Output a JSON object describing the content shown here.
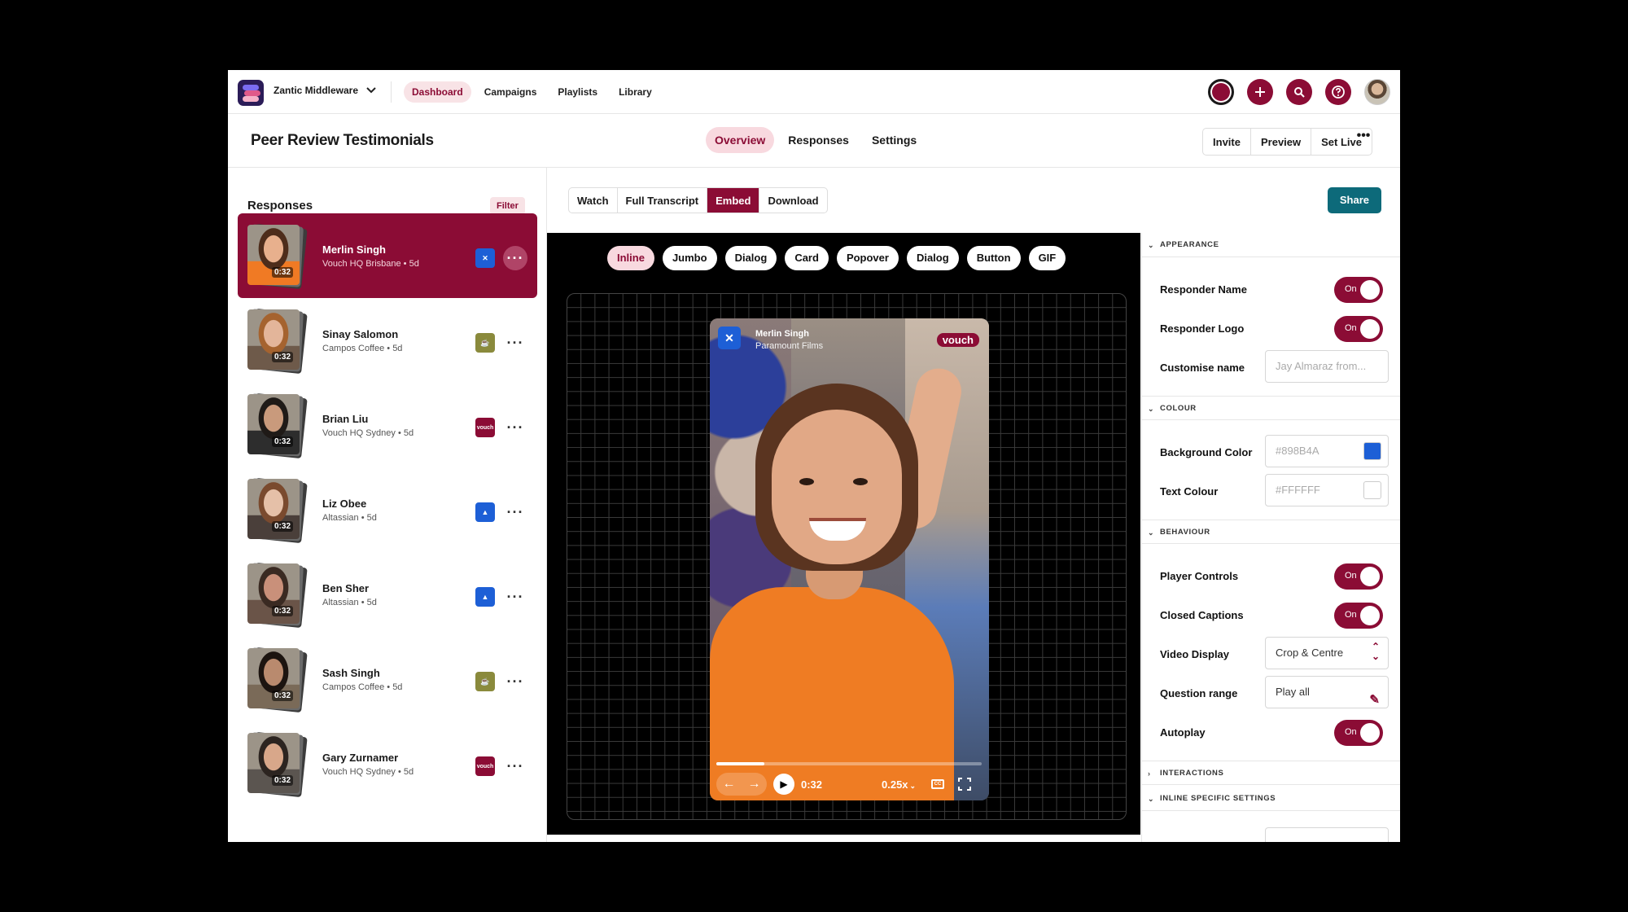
{
  "nav": {
    "org_name": "Zantic Middleware",
    "links": [
      "Dashboard",
      "Campaigns",
      "Playlists",
      "Library"
    ],
    "active_link": "Dashboard"
  },
  "page": {
    "title": "Peer Review Testimonials",
    "tabs": [
      "Overview",
      "Responses",
      "Settings"
    ],
    "active_tab": "Overview",
    "actions": [
      "Invite",
      "Preview",
      "Set Live"
    ]
  },
  "responses": {
    "title": "Responses",
    "filter_label": "Filter",
    "items": [
      {
        "name": "Merlin Singh",
        "sub": "Vouch HQ Brisbane • 5d",
        "duration": "0:32",
        "brand": "zantic",
        "brand_color": "#1d5fd6",
        "selected": true
      },
      {
        "name": "Sinay Salomon",
        "sub": "Campos Coffee • 5d",
        "duration": "0:32",
        "brand": "campos",
        "brand_color": "#8a8a3c"
      },
      {
        "name": "Brian Liu",
        "sub": "Vouch HQ Sydney • 5d",
        "duration": "0:32",
        "brand": "vouch",
        "brand_color": "#8b0c35"
      },
      {
        "name": "Liz Obee",
        "sub": "Altassian • 5d",
        "duration": "0:32",
        "brand": "atlassian",
        "brand_color": "#1d5fd6"
      },
      {
        "name": "Ben Sher",
        "sub": "Altassian • 5d",
        "duration": "0:32",
        "brand": "atlassian",
        "brand_color": "#1d5fd6"
      },
      {
        "name": "Sash Singh",
        "sub": "Campos Coffee • 5d",
        "duration": "0:32",
        "brand": "campos",
        "brand_color": "#8a8a3c"
      },
      {
        "name": "Gary Zurnamer",
        "sub": "Vouch HQ Sydney • 5d",
        "duration": "0:32",
        "brand": "vouch",
        "brand_color": "#8b0c35"
      }
    ]
  },
  "toolbar": {
    "segments": [
      "Watch",
      "Full Transcript",
      "Embed",
      "Download"
    ],
    "active_segment": "Embed",
    "share_label": "Share"
  },
  "embed_types": {
    "items": [
      "Inline",
      "Jumbo",
      "Dialog",
      "Card",
      "Popover",
      "Dialog",
      "Button",
      "GIF"
    ],
    "active": "Inline"
  },
  "player": {
    "responder_name": "Merlin Singh",
    "responder_org": "Paramount Films",
    "brand_badge": "vouch",
    "time": "0:32",
    "speed": "0.25x",
    "cc_label": "CC",
    "progress_fraction": 0.18
  },
  "settings": {
    "appearance": {
      "header": "APPEARANCE",
      "responder_name_label": "Responder Name",
      "responder_logo_label": "Responder Logo",
      "customise_name_label": "Customise name",
      "customise_name_placeholder": "Jay Almaraz from..."
    },
    "colour": {
      "header": "COLOUR",
      "background_label": "Background Color",
      "background_value": "#898B4A",
      "background_swatch": "#1d5fd6",
      "text_label": "Text Colour",
      "text_value": "#FFFFFF",
      "text_swatch": "#ffffff"
    },
    "behaviour": {
      "header": "BEHAVIOUR",
      "player_controls_label": "Player Controls",
      "closed_captions_label": "Closed Captions",
      "video_display_label": "Video Display",
      "video_display_value": "Crop & Centre",
      "question_range_label": "Question range",
      "question_range_value": "Play all",
      "autoplay_label": "Autoplay"
    },
    "interactions_header": "INTERACTIONS",
    "inline_header": "INLINE SPECIFIC SETTINGS",
    "toggle_on_label": "On"
  },
  "colors": {
    "brand": "#8b0c35",
    "brand_light": "#f8e3e6",
    "share": "#0d6a7a"
  }
}
